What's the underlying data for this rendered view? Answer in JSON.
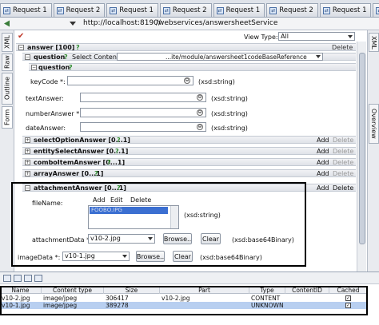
{
  "tabs": [
    {
      "label": "Request 1"
    },
    {
      "label": "Request 2"
    },
    {
      "label": "Request 1"
    },
    {
      "label": "Request 2"
    },
    {
      "label": "Request 1"
    },
    {
      "label": "Request 2"
    },
    {
      "label": "Request 1"
    },
    {
      "label": "Request 2"
    },
    {
      "label": "Request 1"
    },
    {
      "label": "Request 2"
    },
    {
      "label": "Request 1"
    }
  ],
  "url": {
    "host": "http://localhost:8190/",
    "path": "/webservices/answersheetService"
  },
  "left_tabs": [
    "XML",
    "Raw",
    "Outline",
    "Form"
  ],
  "right_tabs": [
    "XML",
    "Overview"
  ],
  "view_type": {
    "label": "View Type:",
    "value": "All"
  },
  "form": {
    "answer": {
      "label": "answer [100]",
      "q": "?",
      "delete": "Delete"
    },
    "question": {
      "label": "question",
      "q": "?",
      "select_content": "Select Content:",
      "select_value": "...ite/module/answersheet1codeBaseReference"
    },
    "question_inner": {
      "label": "question",
      "q": "?"
    },
    "keyCode": {
      "label": "keyCode *:",
      "type": "(xsd:string)"
    },
    "textAnswer": {
      "label": "textAnswer:",
      "type": "(xsd:string)"
    },
    "numberAnswer": {
      "label": "numberAnswer *:",
      "type": "(xsd:string)"
    },
    "dateAnswer": {
      "label": "dateAnswer:",
      "type": "(xsd:string)"
    },
    "sections": [
      {
        "label": "selectOptionAnswer [0...1]",
        "q": "?",
        "add": "Add",
        "delete": "Delete"
      },
      {
        "label": "entitySelectAnswer [0...1]",
        "q": "?",
        "add": "Add",
        "delete": "Delete"
      },
      {
        "label": "comboItemAnswer [0...1]",
        "q": "?",
        "add": "Add",
        "delete": "Delete"
      },
      {
        "label": "arrayAnswer [0...1]",
        "q": "?",
        "add": "Add",
        "delete": "Delete"
      }
    ],
    "attachmentAnswer": {
      "label": "attachmentAnswer [0...1]",
      "q": "?",
      "add": "Add",
      "delete": "Delete",
      "fileName_label": "fileName:",
      "list_add": "Add",
      "list_edit": "Edit",
      "list_delete": "Delete",
      "list_item": "FOOBO.IPG",
      "fileName_type": "(xsd:string)",
      "attachmentData_label": "attachmentData *:",
      "attachmentData_value": "v10-2.jpg",
      "browse": "Browse..",
      "clear": "Clear",
      "attachmentData_type": "(xsd:base64Binary)",
      "imageData_label": "imageData *:",
      "imageData_value": "v10-1.jpg",
      "imageData_type": "(xsd:base64Binary)"
    }
  },
  "attachments_table": {
    "headers": [
      "Name",
      "Content type",
      "Size",
      "Part",
      "Type",
      "ContentID",
      "Cached"
    ],
    "rows": [
      [
        "v10-2.jpg",
        "image/jpeg",
        "306417",
        "v10-2.jpg",
        "CONTENT",
        "",
        true
      ],
      [
        "v10-1.jpg",
        "image/jpeg",
        "389278",
        "",
        "UNKNOWN",
        "",
        true
      ]
    ]
  }
}
